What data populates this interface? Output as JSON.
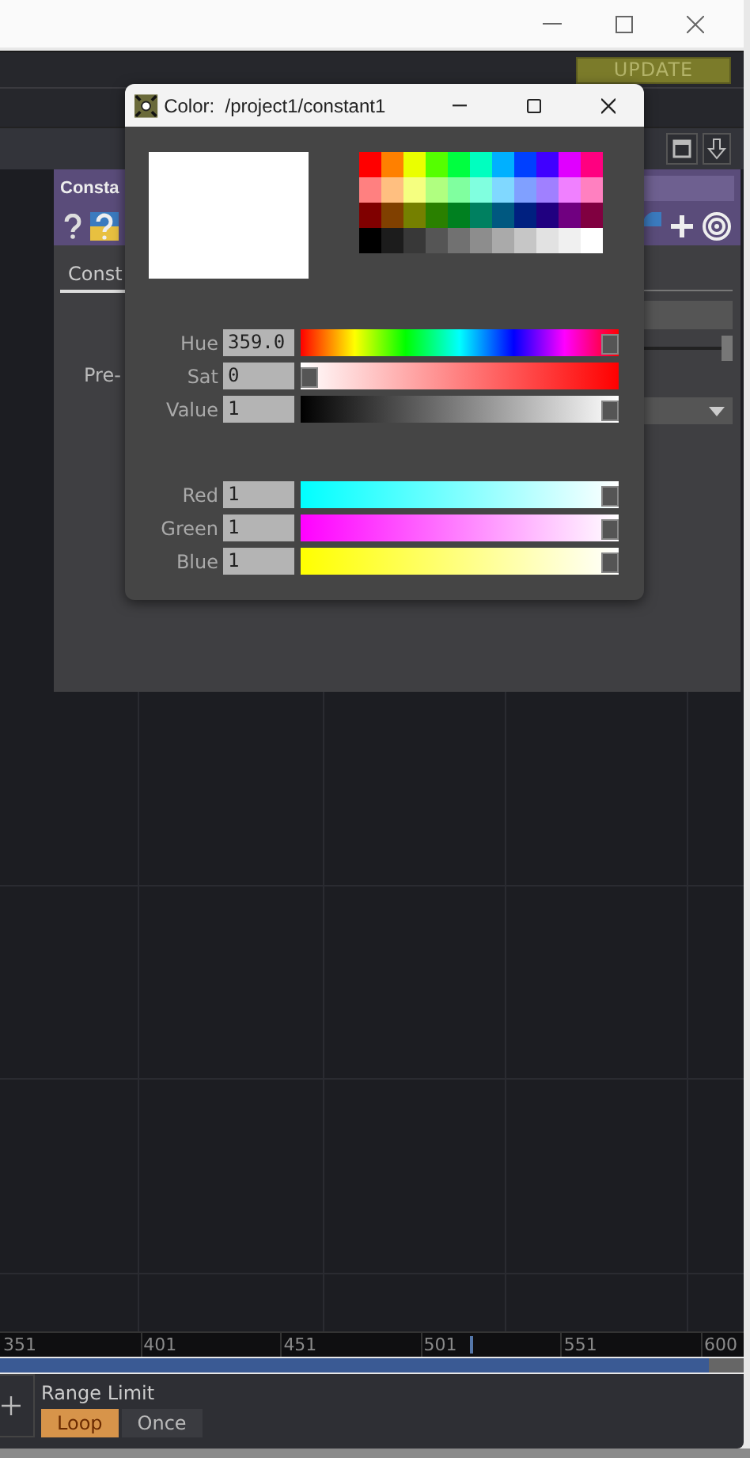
{
  "toolbar": {
    "update_button": "UPDATE"
  },
  "parameter_panel": {
    "title": "Consta",
    "tab": "Const",
    "param_label": "Pre-",
    "slider": {
      "level": 1
    }
  },
  "color_dialog": {
    "title": "Color:  /project1/constant1",
    "preview": {
      "color": "#ffffff"
    },
    "swatches": [
      {
        "color": "#ff0000"
      },
      {
        "color": "#ff8000"
      },
      {
        "color": "#eaff00"
      },
      {
        "color": "#55ff00"
      },
      {
        "color": "#00ff40"
      },
      {
        "color": "#00ffbf"
      },
      {
        "color": "#00b0ff"
      },
      {
        "color": "#0040ff"
      },
      {
        "color": "#4000ff"
      },
      {
        "color": "#e000ff"
      },
      {
        "color": "#ff0080"
      },
      {
        "color": "#ff8080"
      },
      {
        "color": "#ffbf80"
      },
      {
        "color": "#f5ff80"
      },
      {
        "color": "#b0ff80"
      },
      {
        "color": "#80ff9f"
      },
      {
        "color": "#80ffdf"
      },
      {
        "color": "#80d8ff"
      },
      {
        "color": "#80a0ff"
      },
      {
        "color": "#a080ff"
      },
      {
        "color": "#f080ff"
      },
      {
        "color": "#ff80c0"
      },
      {
        "color": "#800000"
      },
      {
        "color": "#804000"
      },
      {
        "color": "#758000"
      },
      {
        "color": "#2a8000"
      },
      {
        "color": "#008020"
      },
      {
        "color": "#008060"
      },
      {
        "color": "#005880"
      },
      {
        "color": "#002080"
      },
      {
        "color": "#200080"
      },
      {
        "color": "#700080"
      },
      {
        "color": "#800040"
      },
      {
        "color": "#000000"
      },
      {
        "color": "#1c1c1c"
      },
      {
        "color": "#383838"
      },
      {
        "color": "#555555"
      },
      {
        "color": "#717171"
      },
      {
        "color": "#8d8d8d"
      },
      {
        "color": "#aaaaaa"
      },
      {
        "color": "#c6c6c6"
      },
      {
        "color": "#e2e2e2"
      },
      {
        "color": "#f0f0f0"
      },
      {
        "color": "#ffffff"
      }
    ],
    "slider_groups": [
      [
        {
          "label": "Hue",
          "value": "359.0",
          "kind": "hue",
          "level": 1
        },
        {
          "label": "Sat",
          "value": "0",
          "kind": "sat",
          "level": 0
        },
        {
          "label": "Value",
          "value": "1",
          "kind": "value",
          "level": 1
        }
      ],
      [
        {
          "label": "Red",
          "value": "1",
          "kind": "red",
          "level": 1
        },
        {
          "label": "Green",
          "value": "1",
          "kind": "green",
          "level": 1
        },
        {
          "label": "Blue",
          "value": "1",
          "kind": "blue",
          "level": 1
        }
      ]
    ]
  },
  "timeline": {
    "ticks": [
      "351",
      "401",
      "451",
      "501",
      "551",
      "600"
    ]
  },
  "range_limit": {
    "label": "Range Limit",
    "options": [
      {
        "label": "Loop",
        "selected": true
      },
      {
        "label": "Once",
        "selected": false
      }
    ]
  }
}
